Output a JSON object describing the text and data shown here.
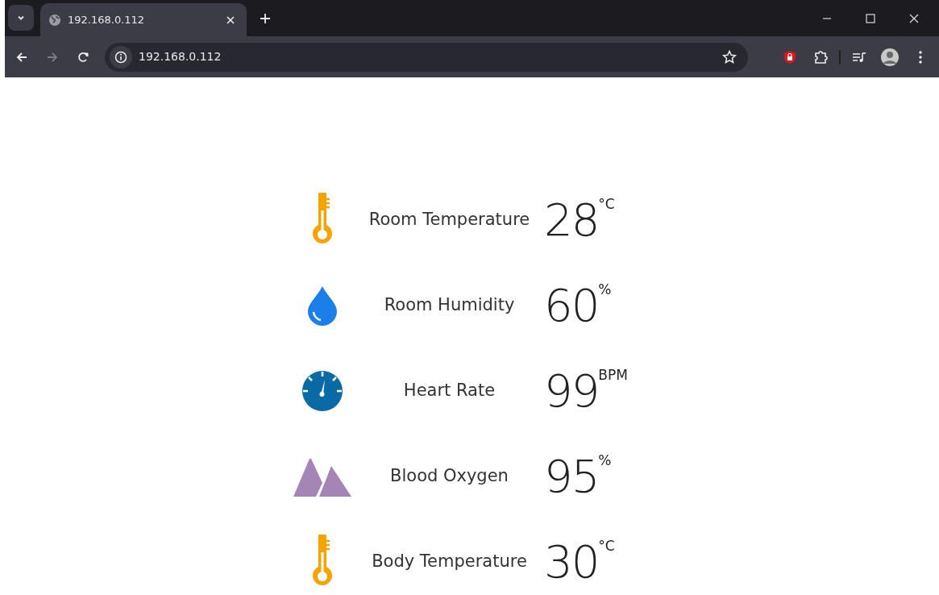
{
  "browser": {
    "tabs": [
      {
        "title": "192.168.0.112",
        "selected": true
      }
    ],
    "address": "192.168.0.112",
    "forward_disabled": true
  },
  "readings": [
    {
      "kind": "thermometer",
      "color": "#f5a300",
      "label": "Room Temperature",
      "value": "28",
      "unit": "°C"
    },
    {
      "kind": "drop",
      "color": "#1a7fe8",
      "label": "Room Humidity",
      "value": "60",
      "unit": "%"
    },
    {
      "kind": "gauge",
      "color": "#0a6aa6",
      "label": "Heart Rate",
      "value": "99",
      "unit": "BPM"
    },
    {
      "kind": "mountains",
      "color": "#a584b6",
      "label": "Blood Oxygen",
      "value": "95",
      "unit": "%"
    },
    {
      "kind": "thermometer",
      "color": "#f5a300",
      "label": "Body Temperature",
      "value": "30",
      "unit": "°C"
    }
  ]
}
